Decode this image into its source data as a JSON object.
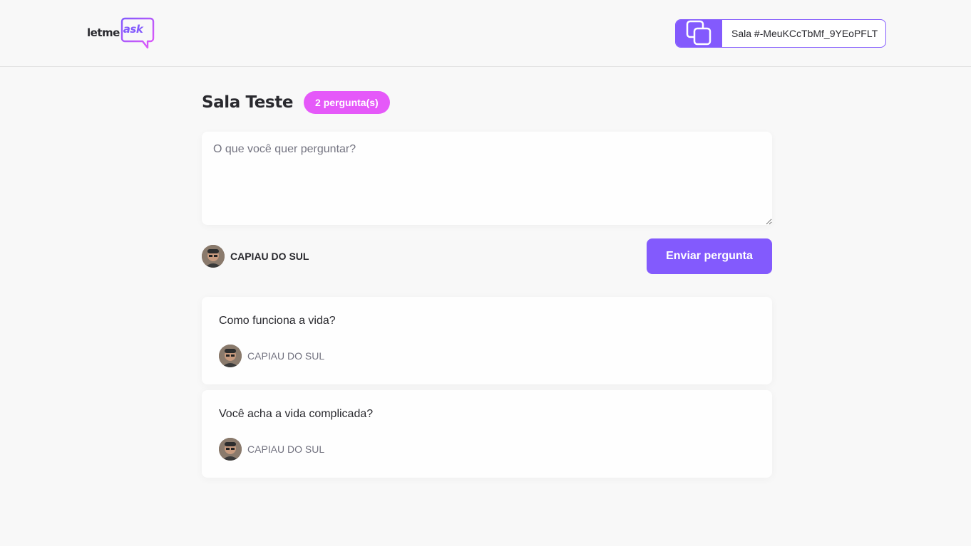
{
  "header": {
    "logo": {
      "text": "letme",
      "accent": "ask",
      "accent_color": "#835afd"
    },
    "room_code": {
      "text": "Sala #-MeuKCcTbMf_9YEoPFLT",
      "icon": "copy-icon",
      "color": "#835afd"
    }
  },
  "room": {
    "title": "Sala Teste",
    "question_count": "2 pergunta(s)",
    "badge_color": "#e559f9"
  },
  "form": {
    "placeholder": "O que você quer perguntar?",
    "value": "",
    "user_name": "CAPIAU DO SUL",
    "submit_label": "Enviar pergunta",
    "submit_color": "#835afd"
  },
  "questions": [
    {
      "content": "Como funciona a vida?",
      "author": "CAPIAU DO SUL"
    },
    {
      "content": "Você acha a vida complicada?",
      "author": "CAPIAU DO SUL"
    }
  ]
}
